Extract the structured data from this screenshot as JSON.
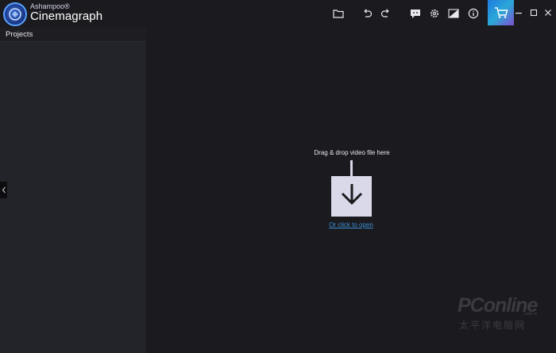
{
  "app": {
    "brand": "Ashampoo®",
    "name": "Cinemagraph"
  },
  "toolbar": {
    "icons": [
      "folder-icon",
      "undo-icon",
      "redo-icon",
      "feedback-icon",
      "settings-icon",
      "theme-icon",
      "info-icon",
      "cart-icon"
    ],
    "accent_gradient": [
      "#1f7be0",
      "#2aa8d8",
      "#7f4fd0"
    ]
  },
  "window_controls": [
    "minimize-icon",
    "maximize-icon",
    "close-icon"
  ],
  "sidebar": {
    "title": "Projects"
  },
  "dropzone": {
    "instruction": "Drag & drop video file here",
    "open_link": "Or click to open"
  },
  "watermark": {
    "text": "PConline",
    "domain": ".com.cn",
    "cn": "太平洋电脑网"
  },
  "colors": {
    "background": "#1b1b1f",
    "sidebar": "#23232a",
    "dropbox": "#d9d9ea",
    "link": "#3b8fd6"
  }
}
